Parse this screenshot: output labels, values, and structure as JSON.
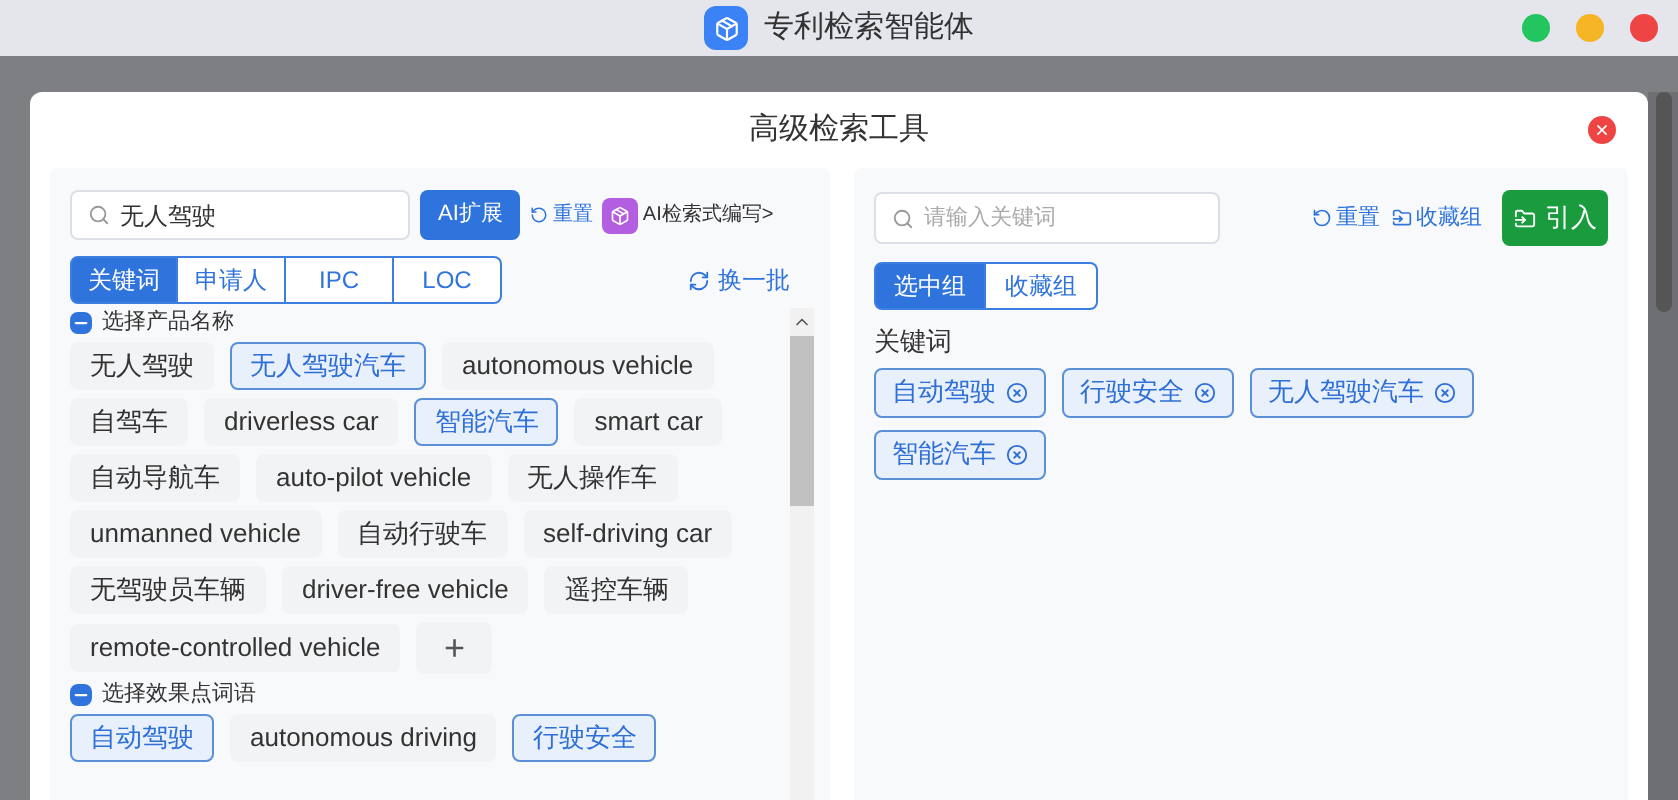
{
  "window": {
    "title": "专利检索智能体"
  },
  "dialog": {
    "title": "高级检索工具"
  },
  "left": {
    "search": {
      "value": "无人驾驶"
    },
    "ai_expand": "AI扩展",
    "reset": "重置",
    "ai_write": "AI检索式编写>",
    "tabs": [
      {
        "label": "关键词",
        "selected": true
      },
      {
        "label": "申请人",
        "selected": false
      },
      {
        "label": "IPC",
        "selected": false
      },
      {
        "label": "LOC",
        "selected": false
      }
    ],
    "refresh": "换一批",
    "groups": [
      {
        "title": "选择产品名称",
        "checked": true,
        "add": "+",
        "items": [
          {
            "label": "无人驾驶",
            "selected": false
          },
          {
            "label": "无人驾驶汽车",
            "selected": true
          },
          {
            "label": "autonomous vehicle",
            "selected": false
          },
          {
            "label": "自驾车",
            "selected": false
          },
          {
            "label": "driverless car",
            "selected": false
          },
          {
            "label": "智能汽车",
            "selected": true
          },
          {
            "label": "smart car",
            "selected": false
          },
          {
            "label": "自动导航车",
            "selected": false
          },
          {
            "label": "auto-pilot vehicle",
            "selected": false
          },
          {
            "label": "无人操作车",
            "selected": false
          },
          {
            "label": "unmanned vehicle",
            "selected": false
          },
          {
            "label": "自动行驶车",
            "selected": false
          },
          {
            "label": "self-driving car",
            "selected": false
          },
          {
            "label": "无驾驶员车辆",
            "selected": false
          },
          {
            "label": "driver-free vehicle",
            "selected": false
          },
          {
            "label": "遥控车辆",
            "selected": false
          },
          {
            "label": "remote-controlled vehicle",
            "selected": false
          }
        ]
      },
      {
        "title": "选择效果点词语",
        "checked": true,
        "items": [
          {
            "label": "自动驾驶",
            "selected": true
          },
          {
            "label": "autonomous driving",
            "selected": false
          },
          {
            "label": "行驶安全",
            "selected": true
          }
        ]
      }
    ]
  },
  "right": {
    "search": {
      "placeholder": "请输入关键词"
    },
    "reset": "重置",
    "favorites": "收藏组",
    "import": "引入",
    "tabs": [
      {
        "label": "选中组",
        "selected": true
      },
      {
        "label": "收藏组",
        "selected": false
      }
    ],
    "section": "关键词",
    "chips": [
      "自动驾驶",
      "行驶安全",
      "无人驾驶汽车",
      "智能汽车"
    ]
  }
}
